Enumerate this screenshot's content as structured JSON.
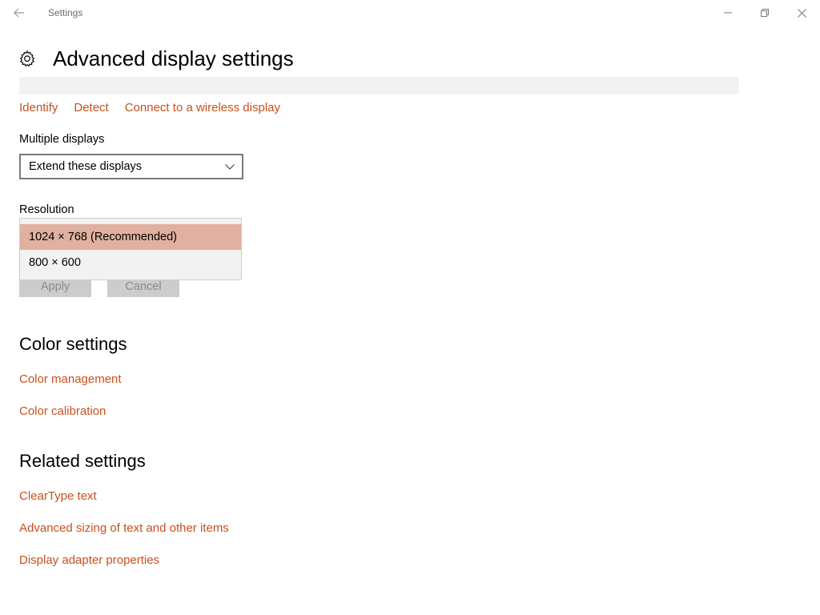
{
  "window": {
    "title": "Settings"
  },
  "header": {
    "title": "Advanced display settings"
  },
  "display_links": [
    {
      "label": "Identify"
    },
    {
      "label": "Detect"
    },
    {
      "label": "Connect to a wireless display"
    }
  ],
  "multiple_displays": {
    "label": "Multiple displays",
    "value": "Extend these displays"
  },
  "resolution": {
    "label": "Resolution",
    "options": [
      {
        "label": "1024 × 768 (Recommended)",
        "selected": true
      },
      {
        "label": "800 × 600",
        "selected": false
      }
    ]
  },
  "buttons": {
    "apply": "Apply",
    "cancel": "Cancel"
  },
  "color_settings": {
    "heading": "Color settings",
    "links": [
      {
        "label": "Color management"
      },
      {
        "label": "Color calibration"
      }
    ]
  },
  "related_settings": {
    "heading": "Related settings",
    "links": [
      {
        "label": "ClearType text"
      },
      {
        "label": "Advanced sizing of text and other items"
      },
      {
        "label": "Display adapter properties"
      }
    ]
  },
  "colors": {
    "accent_link": "#c8501d",
    "selected_option": "#e1b09e",
    "disabled_button": "#cccccc"
  }
}
